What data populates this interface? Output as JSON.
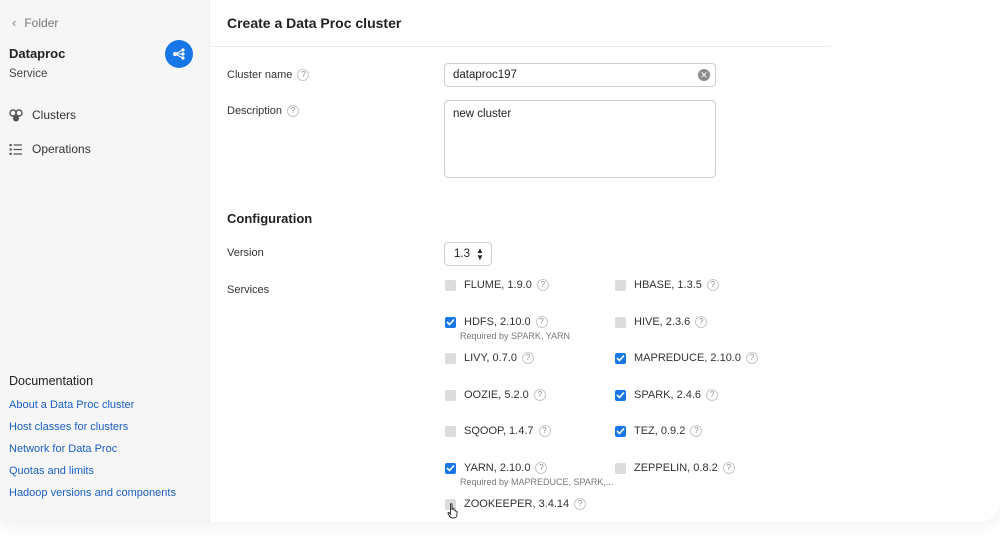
{
  "sidebar": {
    "back_label": "Folder",
    "service_title": "Dataproc",
    "service_subtitle": "Service",
    "nav": [
      {
        "label": "Clusters",
        "icon": "clusters-icon"
      },
      {
        "label": "Operations",
        "icon": "operations-icon"
      }
    ],
    "docs_title": "Documentation",
    "docs_links": [
      "About a Data Proc cluster",
      "Host classes for clusters",
      "Network for Data Proc",
      "Quotas and limits",
      "Hadoop versions and components"
    ]
  },
  "main": {
    "title": "Create a Data Proc cluster",
    "cluster_name": {
      "label": "Cluster name",
      "value": "dataproc197"
    },
    "description": {
      "label": "Description",
      "value": "new cluster"
    },
    "configuration": {
      "title": "Configuration",
      "version_label": "Version",
      "version_value": "1.3",
      "services_label": "Services",
      "services": [
        {
          "name": "FLUME, 1.9.0",
          "checked": false
        },
        {
          "name": "HBASE, 1.3.5",
          "checked": false
        },
        {
          "name": "HDFS, 2.10.0",
          "checked": true,
          "note": "Required by SPARK, YARN"
        },
        {
          "name": "HIVE, 2.3.6",
          "checked": false
        },
        {
          "name": "LIVY, 0.7.0",
          "checked": false
        },
        {
          "name": "MAPREDUCE, 2.10.0",
          "checked": true
        },
        {
          "name": "OOZIE, 5.2.0",
          "checked": false
        },
        {
          "name": "SPARK, 2.4.6",
          "checked": true
        },
        {
          "name": "SQOOP, 1.4.7",
          "checked": false
        },
        {
          "name": "TEZ, 0.9.2",
          "checked": true
        },
        {
          "name": "YARN, 2.10.0",
          "checked": true,
          "note": "Required by MAPREDUCE, SPARK,..."
        },
        {
          "name": "ZEPPELIN, 0.8.2",
          "checked": false
        },
        {
          "name": "ZOOKEEPER, 3.4.14",
          "checked": false
        }
      ]
    }
  },
  "colors": {
    "accent": "#1877e6",
    "link": "#1a5fc4",
    "sidebar_bg": "#f6f6f7"
  }
}
